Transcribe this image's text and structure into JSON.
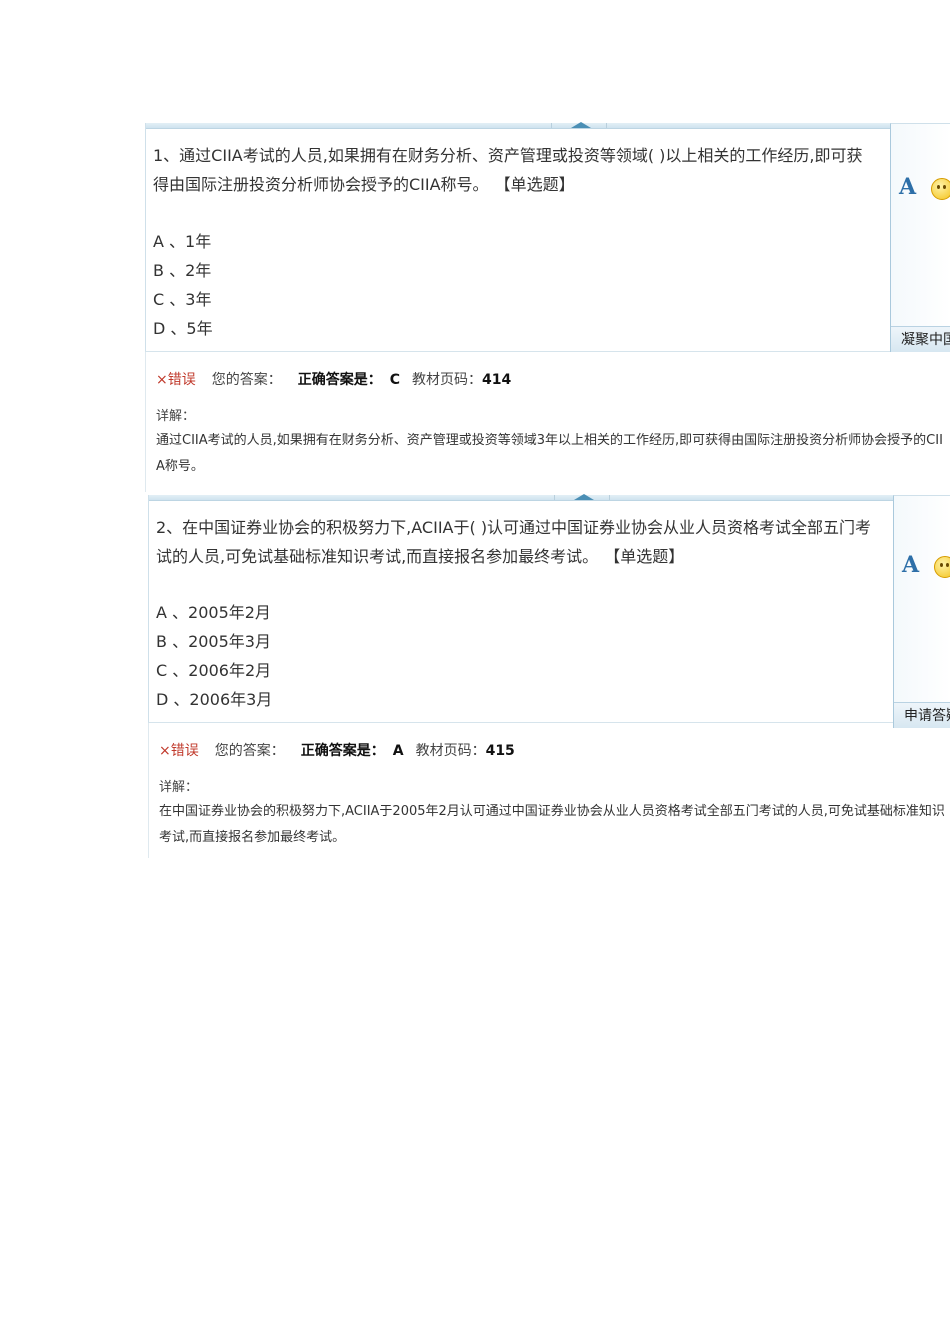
{
  "questions": [
    {
      "number": "1",
      "text": "1、通过CIIA考试的人员,如果拥有在财务分析、资产管理或投资等领域( )以上相关的工作经历,即可获得由国际注册投资分析师协会授予的CIIA称号。",
      "type": "【单选题】",
      "options": [
        "A 、1年",
        "B 、2年",
        "C 、3年",
        "D 、5年"
      ],
      "side_icon_letter": "A",
      "side_footer": "凝聚中国",
      "result_icon": "×",
      "result_label": "错误",
      "your_answer_label": "您的答案：",
      "correct_answer_label": "正确答案是：",
      "correct_answer": "C",
      "page_label": "教材页码：",
      "page_number": "414",
      "detail_label": "详解：",
      "detail_text": "通过CIIA考试的人员,如果拥有在财务分析、资产管理或投资等领域3年以上相关的工作经历,即可获得由国际注册投资分析师协会授予的CIIA称号。"
    },
    {
      "number": "2",
      "text": "2、在中国证券业协会的积极努力下,ACIIA于( )认可通过中国证券业协会从业人员资格考试全部五门考试的人员,可免试基础标准知识考试,而直接报名参加最终考试。",
      "type": "【单选题】",
      "options": [
        "A 、2005年2月",
        "B 、2005年3月",
        "C 、2006年2月",
        "D 、2006年3月"
      ],
      "side_icon_letter": "A",
      "side_footer": "申请答疑",
      "result_icon": "×",
      "result_label": "错误",
      "your_answer_label": "您的答案：",
      "correct_answer_label": "正确答案是：",
      "correct_answer": "A",
      "page_label": "教材页码：",
      "page_number": "415",
      "detail_label": "详解：",
      "detail_text": "在中国证券业协会的积极努力下,ACIIA于2005年2月认可通过中国证券业协会从业人员资格考试全部五门考试的人员,可免试基础标准知识考试,而直接报名参加最终考试。"
    }
  ],
  "colors": {
    "wrong": "#c0392b",
    "accent": "#2d6fa8",
    "border": "#aac9dc"
  },
  "icons": {
    "font_size": "a-letter-icon",
    "emoji": "smiley-icon",
    "wrong": "x-mark-icon"
  }
}
